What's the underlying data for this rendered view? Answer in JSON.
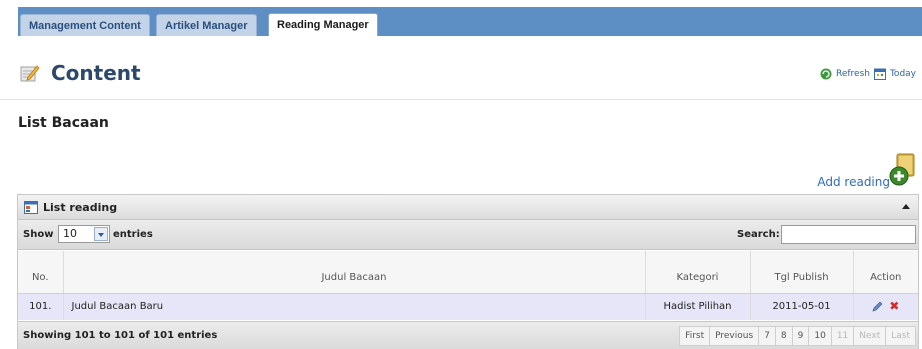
{
  "tabs": [
    {
      "label": "Management Content",
      "active": false
    },
    {
      "label": "Artikel Manager",
      "active": false
    },
    {
      "label": "Reading Manager",
      "active": true
    }
  ],
  "header": {
    "title": "Content",
    "refresh_label": "Refresh",
    "today_label": "Today"
  },
  "section": {
    "title": "List Bacaan"
  },
  "add_reading": {
    "label": "Add reading"
  },
  "panel": {
    "title": "List reading",
    "show_label": "Show",
    "page_size": "10",
    "entries_label": "entries",
    "search_label": "Search:",
    "search_value": ""
  },
  "table": {
    "columns": [
      "No.",
      "Judul Bacaan",
      "Kategori",
      "Tgl Publish",
      "Action"
    ],
    "rows": [
      {
        "no": "101.",
        "judul": "Judul Bacaan Baru",
        "kategori": "Hadist Pilihan",
        "tgl": "2011-05-01"
      }
    ]
  },
  "footer": {
    "info": "Showing 101 to 101 of 101 entries",
    "pager": {
      "first": "First",
      "previous": "Previous",
      "pages": [
        "7",
        "8",
        "9",
        "10",
        "11"
      ],
      "current": "11",
      "next": "Next",
      "last": "Last"
    }
  },
  "colors": {
    "tab_strip": "#5d8ec4",
    "title": "#2b4a6b",
    "link": "#2d6cc1",
    "row_highlight": "#e6e6f8",
    "delete": "#d42a2a"
  },
  "icons": {
    "content": "pencil-note-icon",
    "refresh": "refresh-icon",
    "today": "calendar-icon",
    "add": "add-document-icon",
    "list": "list-icon",
    "edit": "pencil-icon",
    "delete": "delete-x-icon"
  }
}
